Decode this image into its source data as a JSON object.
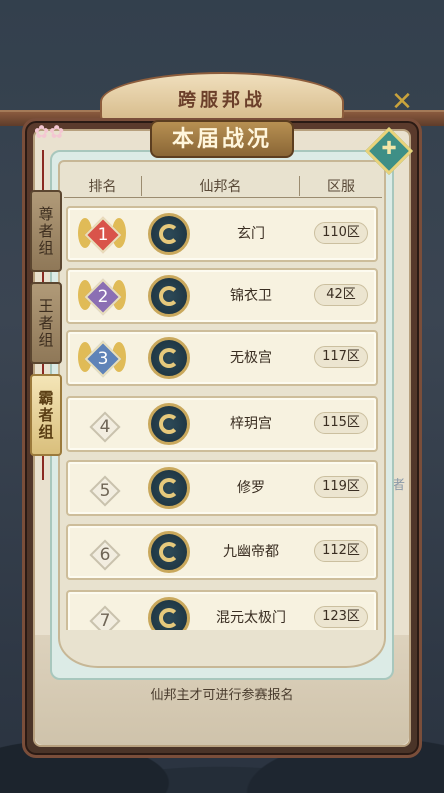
{
  "window": {
    "event_title": "跨服邦战",
    "panel_title": "本届战况"
  },
  "table_header": {
    "rank": "排名",
    "guild": "仙邦名",
    "server": "区服"
  },
  "groups": [
    {
      "label": "尊者组",
      "active": false
    },
    {
      "label": "王者组",
      "active": false
    },
    {
      "label": "霸者组",
      "active": true
    }
  ],
  "rows": [
    {
      "rank": "1",
      "name": "玄门",
      "server": "110区",
      "medal_color": "#d9534a"
    },
    {
      "rank": "2",
      "name": "锦衣卫",
      "server": "42区",
      "medal_color": "#8b6fb3"
    },
    {
      "rank": "3",
      "name": "无极宫",
      "server": "117区",
      "medal_color": "#5f83b8"
    },
    {
      "rank": "4",
      "name": "梓玥宫",
      "server": "115区"
    },
    {
      "rank": "5",
      "name": "修罗",
      "server": "119区"
    },
    {
      "rank": "6",
      "name": "九幽帝都",
      "server": "112区"
    },
    {
      "rank": "7",
      "name": "混元太极门",
      "server": "123区"
    }
  ],
  "footer": {
    "note": "仙邦主才可进行参赛报名"
  },
  "side_right_label": "者",
  "icons": {
    "close": "close-icon",
    "help": "help-icon",
    "emblem": "guild-emblem-icon",
    "flower": "flower-icon"
  }
}
